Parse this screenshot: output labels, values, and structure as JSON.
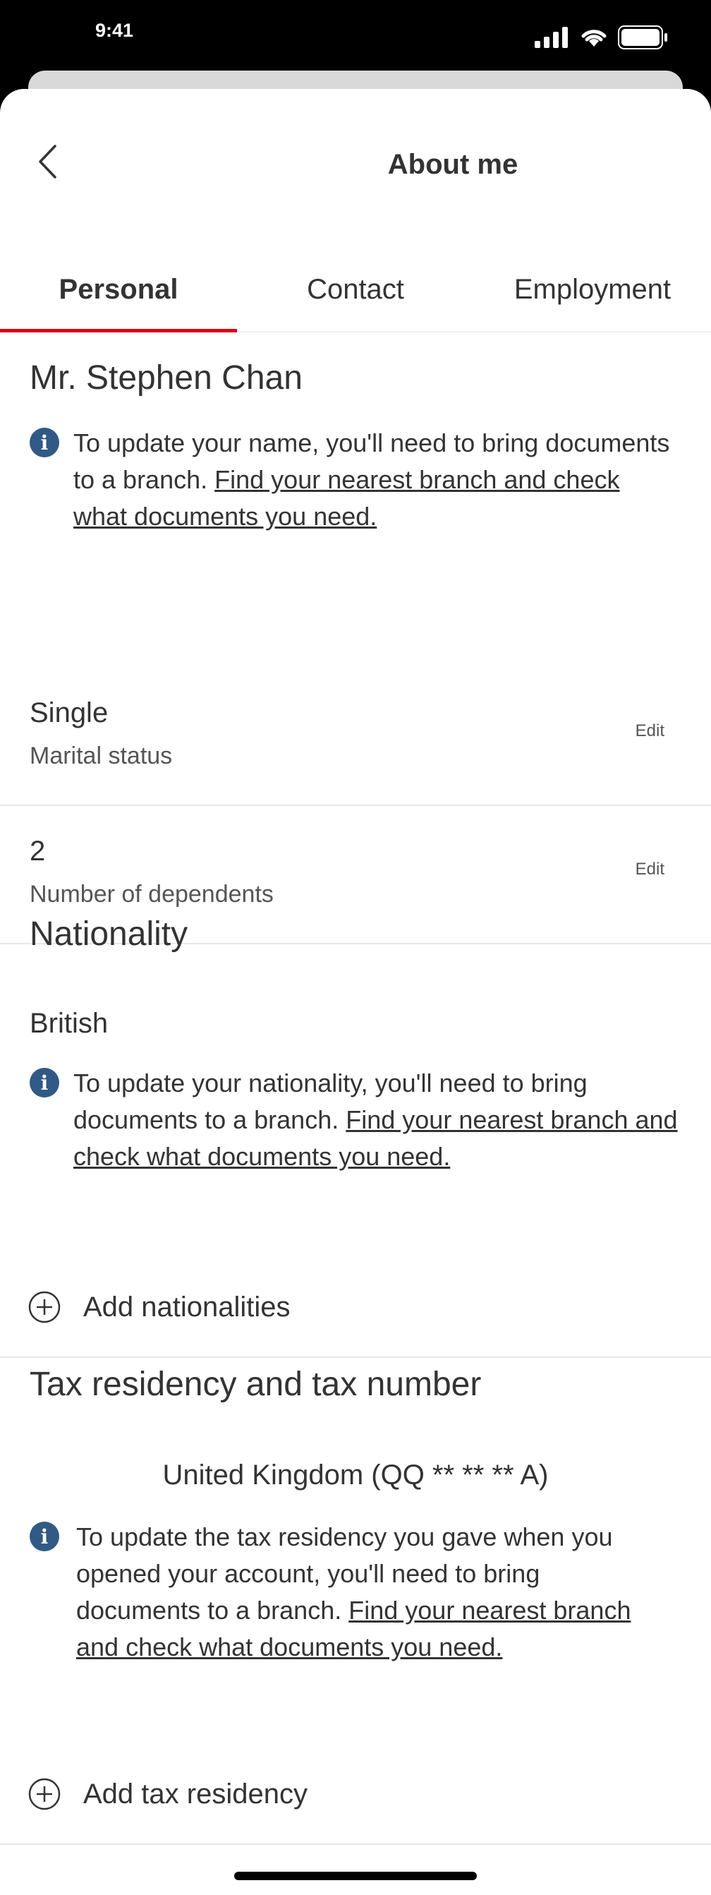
{
  "status_bar": {
    "time": "9:41"
  },
  "header": {
    "title": "About me"
  },
  "tabs": [
    {
      "label": "Personal",
      "active": true
    },
    {
      "label": "Contact",
      "active": false
    },
    {
      "label": "Employment",
      "active": false
    }
  ],
  "personal": {
    "name": "Mr. Stephen Chan",
    "name_info": {
      "text": "To update your name, you'll need to bring documents to a branch.",
      "link": "Find your nearest branch and check what documents you need."
    },
    "marital": {
      "value": "Single",
      "label": "Marital status",
      "edit": "Edit"
    },
    "dependents": {
      "value": "2",
      "label": "Number of dependents",
      "edit": "Edit"
    }
  },
  "nationality": {
    "title": "Nationality",
    "value": "British",
    "info": {
      "text": "To update your nationality, you'll need to bring documents to a branch.",
      "link": "Find your nearest branch and check what documents you need."
    },
    "add_label": "Add nationalities"
  },
  "tax": {
    "title": "Tax residency and tax number",
    "value": "United Kingdom (QQ ** ** ** A)",
    "info": {
      "text": "To update the tax residency you gave when you opened your account, you'll need to bring documents to a branch.",
      "link": "Find your nearest branch and check what documents you need."
    },
    "add_label": "Add tax residency"
  },
  "icons": {
    "back": "chevron-left-icon",
    "info": "info-icon",
    "add": "plus-circle-icon"
  },
  "colors": {
    "accent": "#db0011",
    "info": "#305a85"
  }
}
